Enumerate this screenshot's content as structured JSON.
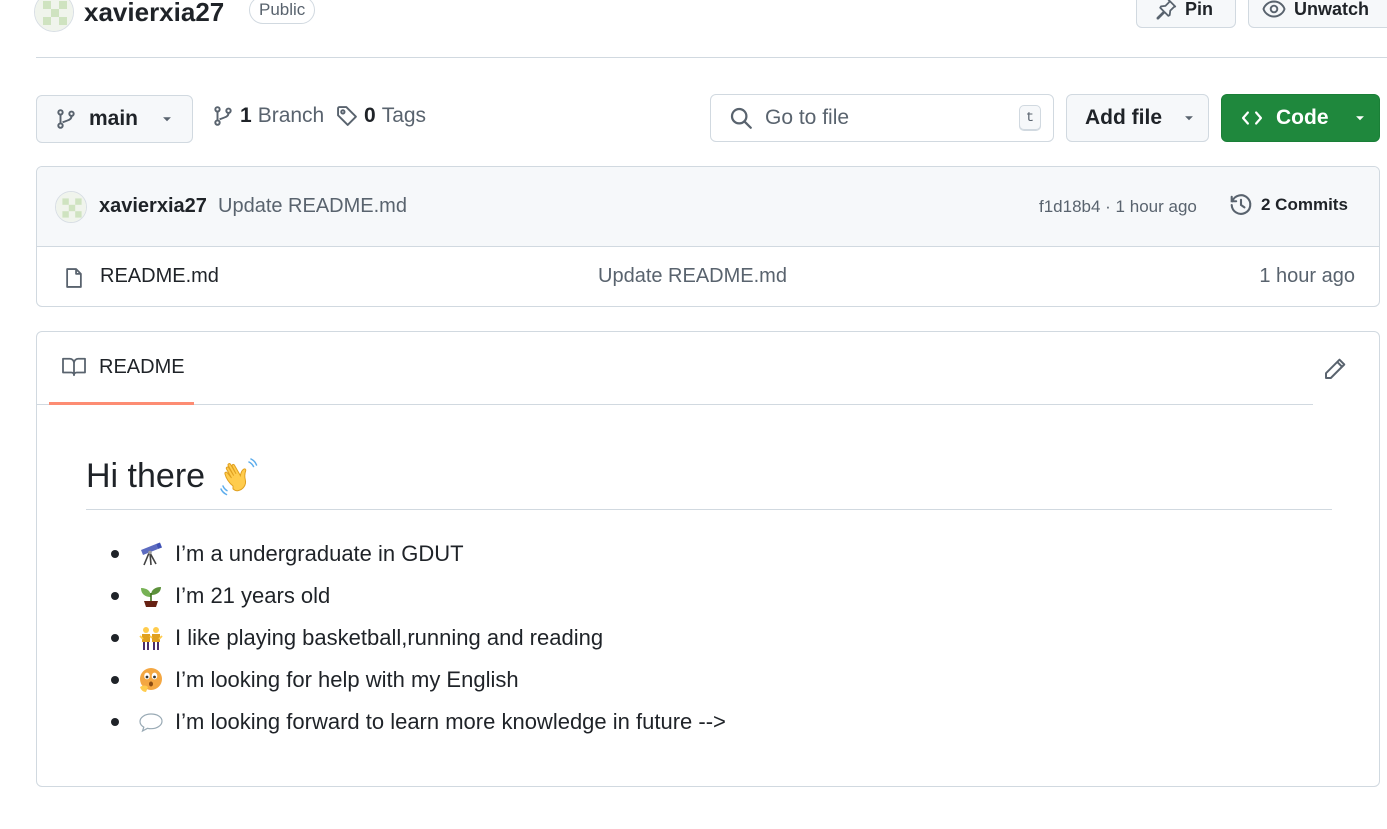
{
  "header": {
    "repo_name": "xavierxia27",
    "visibility": "Public",
    "pin_label": "Pin",
    "unwatch_label": "Unwatch"
  },
  "toolbar": {
    "branch": "main",
    "branch_count": "1",
    "branch_label": "Branch",
    "tag_count": "0",
    "tag_label": "Tags",
    "search_placeholder": "Go to file",
    "search_shortcut": "t",
    "add_file_label": "Add file",
    "code_label": "Code"
  },
  "latest_commit": {
    "author": "xavierxia27",
    "message": "Update README.md",
    "meta": "f1d18b4 · 1 hour ago",
    "commits_label": "2 Commits"
  },
  "files": [
    {
      "name": "README.md",
      "message": "Update README.md",
      "time": "1 hour ago"
    }
  ],
  "readme": {
    "tab_label": "README",
    "heading": "Hi there",
    "items": [
      {
        "emoji": "telescope-icon",
        "text": "I’m a undergraduate in GDUT"
      },
      {
        "emoji": "seedling-icon",
        "text": "I’m 21 years old"
      },
      {
        "emoji": "people-icon",
        "text": "I like playing basketball,running and reading"
      },
      {
        "emoji": "thinking-face-icon",
        "text": "I’m looking for help with my English"
      },
      {
        "emoji": "speech-bubble-icon",
        "text": "I’m looking forward to learn more knowledge in future -->"
      }
    ]
  },
  "colors": {
    "primary_button": "#1f883d",
    "active_tab_underline": "#fd8c73",
    "border": "#d1d9e0",
    "muted_text": "#59636e"
  }
}
